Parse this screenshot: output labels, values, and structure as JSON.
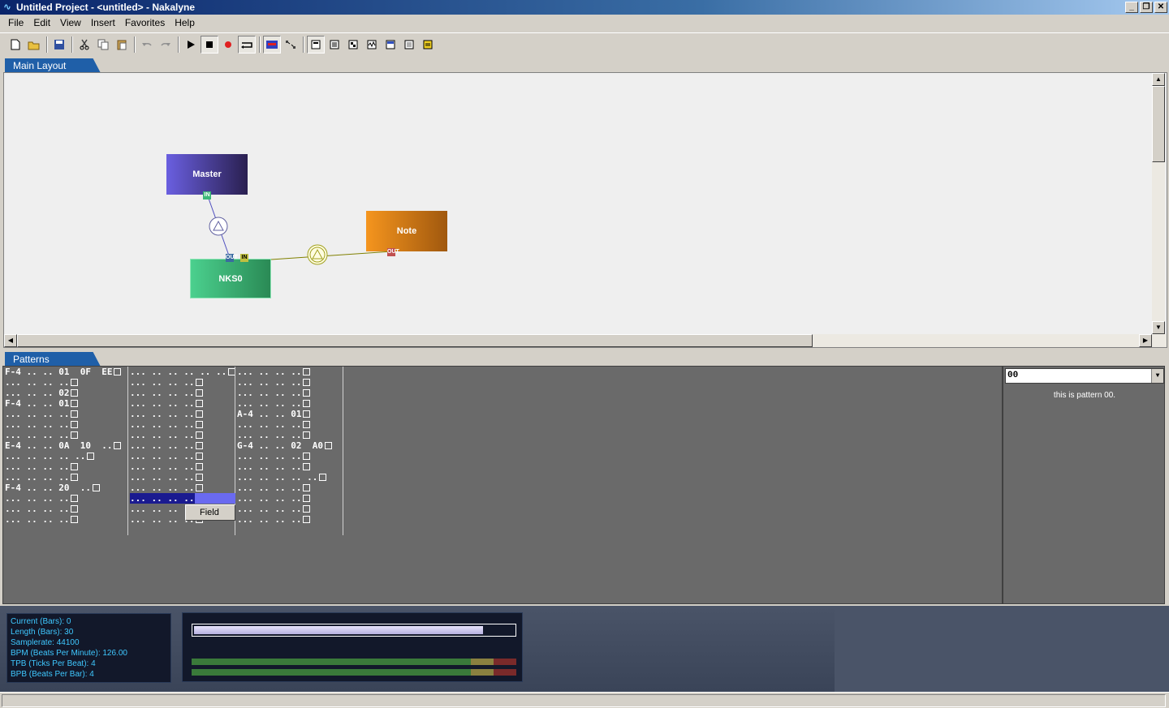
{
  "window": {
    "title": "Untitled Project - <untitled> - Nakalyne",
    "app_icon": "wave-icon",
    "buttons": [
      "_",
      "❐",
      "✕"
    ]
  },
  "menu": [
    "File",
    "Edit",
    "View",
    "Insert",
    "Favorites",
    "Help"
  ],
  "toolbar": {
    "groups": [
      [
        "new-icon",
        "open-icon"
      ],
      [
        "save-icon"
      ],
      [
        "cut-icon",
        "copy-icon",
        "paste-icon"
      ],
      [
        "undo-icon",
        "redo-icon"
      ],
      [
        "play-icon",
        "stop-icon",
        "record-icon",
        "loop-icon"
      ],
      [
        "machine-icon",
        "mixer-icon"
      ],
      [
        "view-layout-icon",
        "view-pattern-icon",
        "view-sequence-icon",
        "view-wave-icon",
        "view-info-icon",
        "view-list-icon",
        "view-comment-icon"
      ]
    ]
  },
  "tabs": {
    "layout": "Main Layout",
    "patterns": "Patterns"
  },
  "machines": {
    "master": {
      "label": "Master",
      "color": "#4a3fc0",
      "port": "IN"
    },
    "note": {
      "label": "Note",
      "color": "#e08a1a",
      "port": "OUT"
    },
    "nks": {
      "label": "NKS0",
      "color": "#3cb878",
      "ports": [
        "OUT",
        "IN"
      ]
    }
  },
  "patterns": {
    "track1": [
      "F-4 .. .. 01  0F  EE",
      "... .. .. ..",
      "... .. .. 02",
      "F-4 .. .. 01",
      "... .. .. ..",
      "... .. .. ..",
      "... .. .. ..",
      "E-4 .. .. 0A  10  ..",
      "... .. .. .. ..",
      "... .. .. ..",
      "... .. .. ..",
      "F-4 .. .. 20  ..",
      "... .. .. ..",
      "... .. .. ..",
      "... .. .. .."
    ],
    "track1_box_cols": [
      3,
      1,
      2,
      1,
      1,
      1,
      1,
      3,
      2,
      1,
      1,
      2,
      1,
      1,
      1
    ],
    "track2": [
      "... .. .. .. .. ..",
      "... .. .. ..",
      "... .. .. ..",
      "... .. .. ..",
      "... .. .. ..",
      "... .. .. ..",
      "... .. .. ..",
      "... .. .. ..",
      "... .. .. ..",
      "... .. .. ..",
      "... .. .. ..",
      "... .. .. ..",
      "... .. .. ..",
      "... .. .. ..",
      "... .. .. .."
    ],
    "track3": [
      "... .. .. ..",
      "... .. .. ..",
      "... .. .. ..",
      "... .. .. ..",
      "A-4 .. .. 01",
      "... .. .. ..",
      "... .. .. ..",
      "G-4 .. .. 02  A0",
      "... .. .. ..",
      "... .. .. ..",
      "... .. .. .. ..",
      "... .. .. ..",
      "... .. .. ..",
      "... .. .. ..",
      "... .. .. .."
    ],
    "selected_row_index": 12,
    "context_menu": "Field"
  },
  "pattern_panel": {
    "selected": "00",
    "description": "this is pattern 00."
  },
  "info": {
    "current": "Current (Bars): 0",
    "length": "Length (Bars): 30",
    "samplerate": "Samplerate: 44100",
    "bpm": "BPM (Beats Per Minute): 126.00",
    "tpb": "TPB (Ticks Per Beat): 4",
    "bpb": "BPB (Beats Per Bar): 4"
  },
  "playback_progress": 0.9,
  "vu_levels": [
    0.86,
    0.86
  ],
  "colors": {
    "tab": "#1f5fa8",
    "info_text": "#3fc8ff",
    "selection": "#1a1a90"
  }
}
